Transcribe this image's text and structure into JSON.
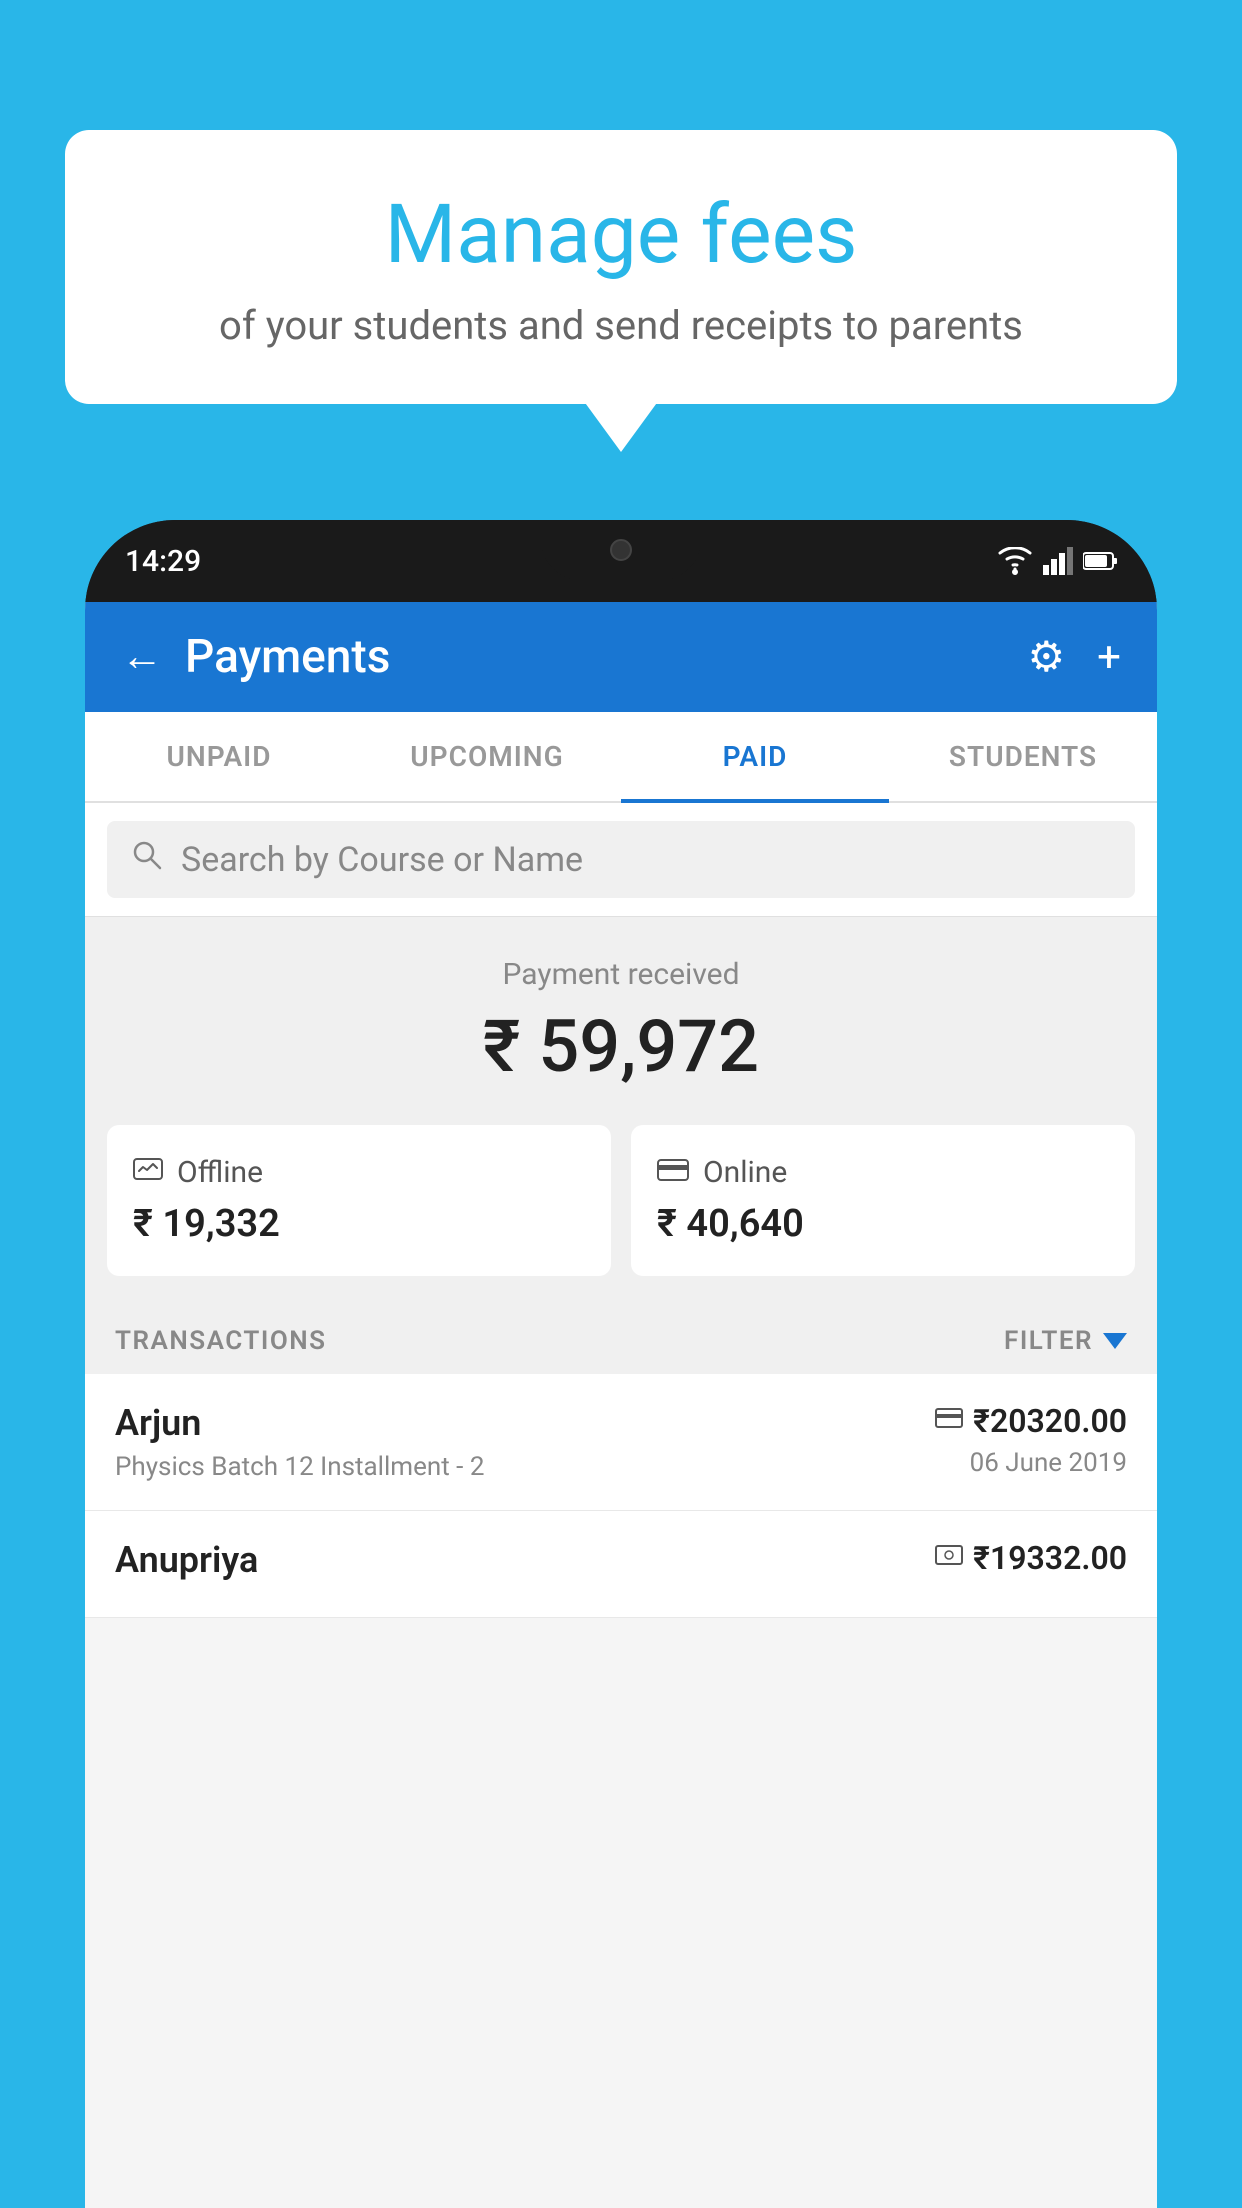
{
  "background_color": "#29B6E8",
  "speech_bubble": {
    "title": "Manage fees",
    "subtitle": "of your students and send receipts to parents"
  },
  "phone": {
    "status_bar": {
      "time": "14:29"
    },
    "header": {
      "title": "Payments",
      "back_label": "←",
      "gear_label": "⚙",
      "plus_label": "+"
    },
    "tabs": [
      {
        "label": "UNPAID",
        "active": false
      },
      {
        "label": "UPCOMING",
        "active": false
      },
      {
        "label": "PAID",
        "active": true
      },
      {
        "label": "STUDENTS",
        "active": false
      }
    ],
    "search": {
      "placeholder": "Search by Course or Name"
    },
    "payment_received": {
      "label": "Payment received",
      "amount": "₹ 59,972"
    },
    "payment_cards": [
      {
        "label": "Offline",
        "amount": "₹ 19,332",
        "icon": "💵"
      },
      {
        "label": "Online",
        "amount": "₹ 40,640",
        "icon": "💳"
      }
    ],
    "transactions_header": {
      "label": "TRANSACTIONS",
      "filter_label": "FILTER"
    },
    "transactions": [
      {
        "name": "Arjun",
        "course": "Physics Batch 12 Installment - 2",
        "amount": "₹20320.00",
        "date": "06 June 2019",
        "payment_type": "card"
      },
      {
        "name": "Anupriya",
        "course": "",
        "amount": "₹19332.00",
        "date": "",
        "payment_type": "cash"
      }
    ]
  }
}
